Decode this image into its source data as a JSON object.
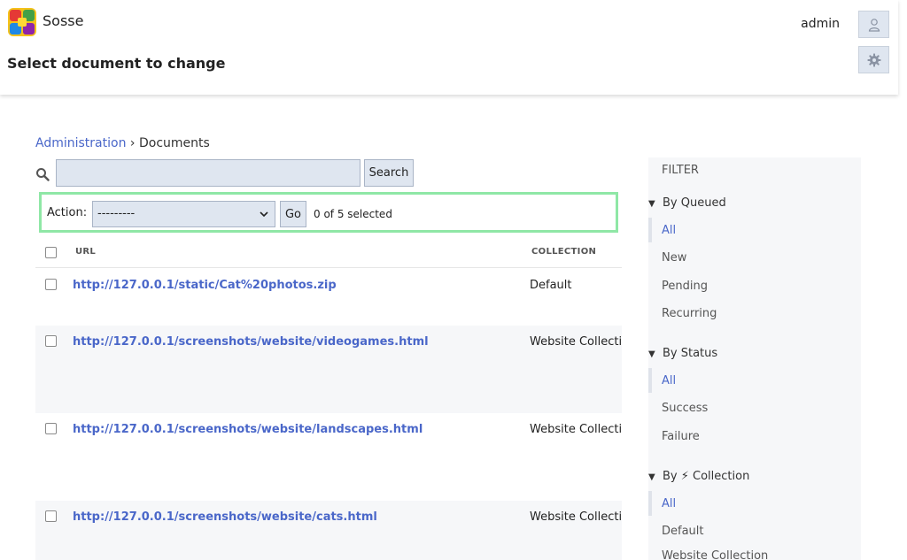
{
  "app": {
    "name": "Sosse",
    "page_title": "Select document to change"
  },
  "user": {
    "name": "admin"
  },
  "icons": {
    "logo": "sosse-logo",
    "user": "user-icon",
    "gear": "gear-icon",
    "search": "search-icon"
  },
  "breadcrumbs": {
    "root": "Administration",
    "separator": "›",
    "current": "Documents"
  },
  "search": {
    "button_label": "Search",
    "value": ""
  },
  "actions": {
    "label": "Action:",
    "selected_option": "---------",
    "go_label": "Go",
    "selection_count": "0 of 5 selected"
  },
  "table": {
    "headers": {
      "url": "URL",
      "collection": "Collection"
    },
    "rows": [
      {
        "url": "http://127.0.0.1/static/Cat%20photos.zip",
        "collection": "Default"
      },
      {
        "url": "http://127.0.0.1/screenshots/website/videogames.html",
        "collection": "Website Collection"
      },
      {
        "url": "http://127.0.0.1/screenshots/website/landscapes.html",
        "collection": "Website Collection"
      },
      {
        "url": "http://127.0.0.1/screenshots/website/cats.html",
        "collection": "Website Collection"
      }
    ]
  },
  "filter": {
    "title": "FILTER",
    "groups": [
      {
        "title": "By Queued",
        "items": [
          "All",
          "New",
          "Pending",
          "Recurring"
        ]
      },
      {
        "title": "By Status",
        "items": [
          "All",
          "Success",
          "Failure"
        ]
      },
      {
        "title": "By ⚡ Collection",
        "items": [
          "All",
          "Default",
          "Website Collection"
        ]
      }
    ]
  },
  "colors": {
    "accent": "#4a67c9",
    "action_border": "#8fe7a6",
    "control_bg": "#dfe6f0"
  }
}
